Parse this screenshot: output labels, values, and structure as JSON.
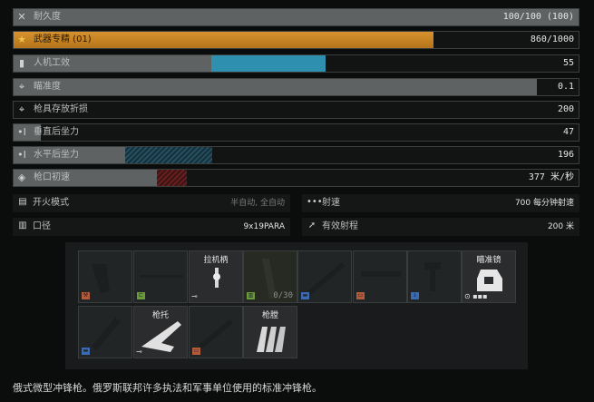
{
  "stats": [
    {
      "icon": "wrench-screwdriver-icon",
      "label": "耐久度",
      "value": "100/100 (100)",
      "fill": 1.0,
      "fill_style": "gray"
    },
    {
      "icon": "star-icon",
      "label": "武器专精 (01)",
      "value": "860/1000",
      "fill": 0.86,
      "fill_style": "orange"
    },
    {
      "icon": "grip-icon",
      "label": "人机工效",
      "value": "55",
      "fill": 0.55,
      "fill_style": "gray-blue"
    },
    {
      "icon": "crosshair-icon",
      "label": "瞄准度",
      "value": "0.1",
      "fill": 0.93,
      "fill_style": "gray"
    },
    {
      "icon": "crosshair-icon",
      "label": "枪具存放折损",
      "value": "200",
      "fill": 0.0,
      "fill_style": "gray"
    },
    {
      "icon": "recoil-icon",
      "label": "垂直后坐力",
      "value": "47",
      "fill": 0.05,
      "fill_style": "gray"
    },
    {
      "icon": "recoil-icon",
      "label": "水平后坐力",
      "value": "196",
      "fill": 0.2,
      "fill_style": "gray-teal"
    },
    {
      "icon": "velocity-icon",
      "label": "枪口初速",
      "value": "377 米/秒",
      "fill": 0.25,
      "fill_style": "gray-red"
    }
  ],
  "details_left": [
    {
      "icon": "fire-mode-icon",
      "label": "开火模式",
      "value": "半自动, 全自动"
    },
    {
      "icon": "caliber-icon",
      "label": "口径",
      "value": "9x19PARA"
    }
  ],
  "details_right": [
    {
      "icon": "rate-icon",
      "label": "射速",
      "value": "700 每分钟射速"
    },
    {
      "icon": "range-icon",
      "label": "有效射程",
      "value": "200 米"
    }
  ],
  "mods": {
    "row1": [
      {
        "name": "slot-pistol-grip",
        "title": "",
        "badge_color": "#b25a3c",
        "filled": false
      },
      {
        "name": "slot-stock-adapter",
        "title": "",
        "badge_color": "#6a9a3c",
        "filled": false
      },
      {
        "name": "slot-charging-handle",
        "title": "拉机柄",
        "badge_color": "",
        "filled": true
      },
      {
        "name": "slot-magazine",
        "title": "",
        "badge_color": "#6a9a3c",
        "filled": false,
        "ammo": "0/30"
      },
      {
        "name": "slot-barrel",
        "title": "",
        "badge_color": "#3c6ab2",
        "filled": false
      },
      {
        "name": "slot-handguard",
        "title": "",
        "badge_color": "#b25a3c",
        "filled": false
      },
      {
        "name": "slot-muzzle",
        "title": "",
        "badge_color": "#3c6ab2",
        "filled": false
      },
      {
        "name": "slot-mount",
        "title": "瞄准镜",
        "badge_color": "",
        "filled": true
      }
    ],
    "row2": [
      {
        "name": "slot-tactical",
        "title": "",
        "badge_color": "#3c6ab2",
        "filled": false
      },
      {
        "name": "slot-stock",
        "title": "枪托",
        "badge_color": "",
        "filled": true
      },
      {
        "name": "slot-rail",
        "title": "",
        "badge_color": "#b25a3c",
        "filled": false
      },
      {
        "name": "slot-ammo",
        "title": "枪膛",
        "badge_color": "",
        "filled": true
      }
    ]
  },
  "description": "俄式微型冲锋枪。俄罗斯联邦许多执法和军事单位使用的标准冲锋枪。"
}
